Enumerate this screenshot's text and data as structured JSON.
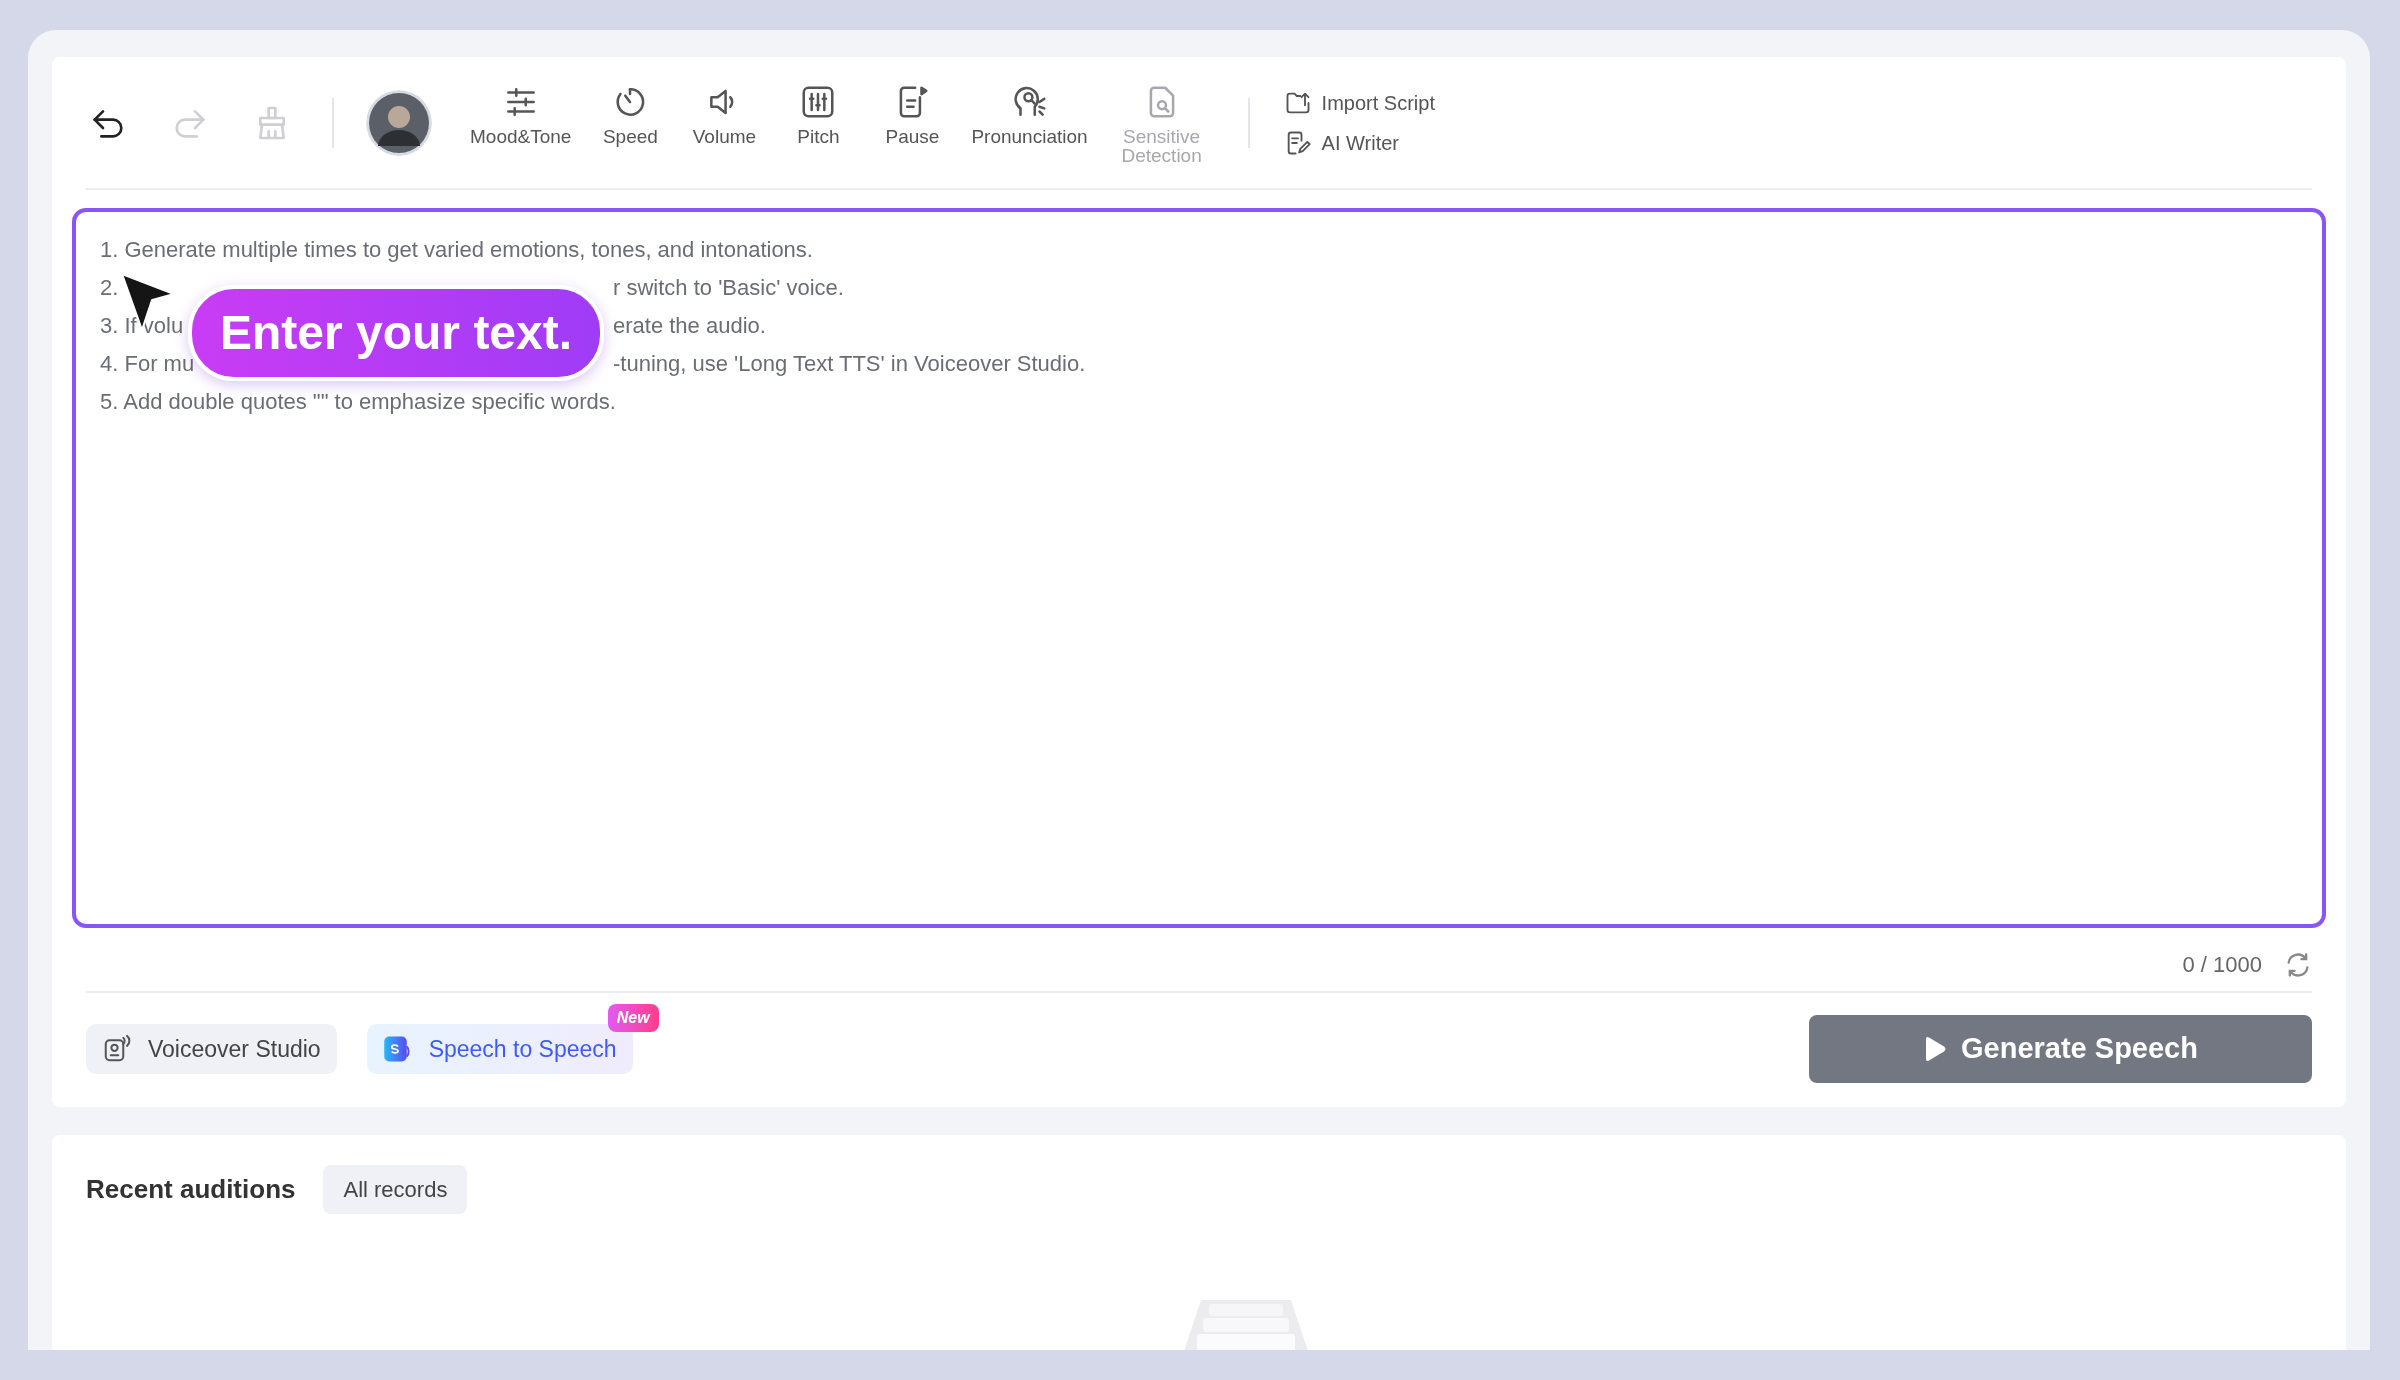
{
  "toolbar": {
    "history": [
      {
        "kind": "undo",
        "disabled": false
      },
      {
        "kind": "redo",
        "disabled": true
      },
      {
        "kind": "clear",
        "disabled": true
      }
    ],
    "tools": [
      {
        "kind": "mood",
        "label": "Mood&Tone",
        "disabled": false
      },
      {
        "kind": "speed",
        "label": "Speed",
        "disabled": false
      },
      {
        "kind": "volume",
        "label": "Volume",
        "disabled": false
      },
      {
        "kind": "pitch",
        "label": "Pitch",
        "disabled": false
      },
      {
        "kind": "pause",
        "label": "Pause",
        "disabled": false
      },
      {
        "kind": "pronunciation",
        "label": "Pronunciation",
        "disabled": false
      },
      {
        "kind": "sensitive",
        "label": "Sensitive Detection",
        "disabled": true
      }
    ],
    "actions": [
      {
        "kind": "import",
        "label": "Import Script"
      },
      {
        "kind": "writer",
        "label": "AI Writer"
      }
    ]
  },
  "editor": {
    "focused": true,
    "lines": [
      {
        "segments": [
          "1. Generate multiple times to get varied emotions, tones, and intonations."
        ]
      },
      {
        "segments": [
          "2.",
          "r switch to 'Basic' voice."
        ]
      },
      {
        "segments": [
          "3. If volu",
          "erate the audio."
        ]
      },
      {
        "segments": [
          "4. For mu",
          "-tuning, use 'Long Text TTS' in Voiceover Studio."
        ]
      },
      {
        "segments": [
          "5. Add double quotes \"\" to emphasize specific words."
        ]
      }
    ],
    "tooltip": "Enter your text.",
    "counter": "0 / 1000"
  },
  "modes": [
    {
      "kind": "studio",
      "label": "Voiceover Studio"
    },
    {
      "kind": "s2s",
      "label": "Speech to Speech",
      "badge": "New"
    }
  ],
  "generate_button": {
    "label": "Generate Speech",
    "disabled": true
  },
  "recent": {
    "title": "Recent auditions",
    "filter": "All records"
  }
}
